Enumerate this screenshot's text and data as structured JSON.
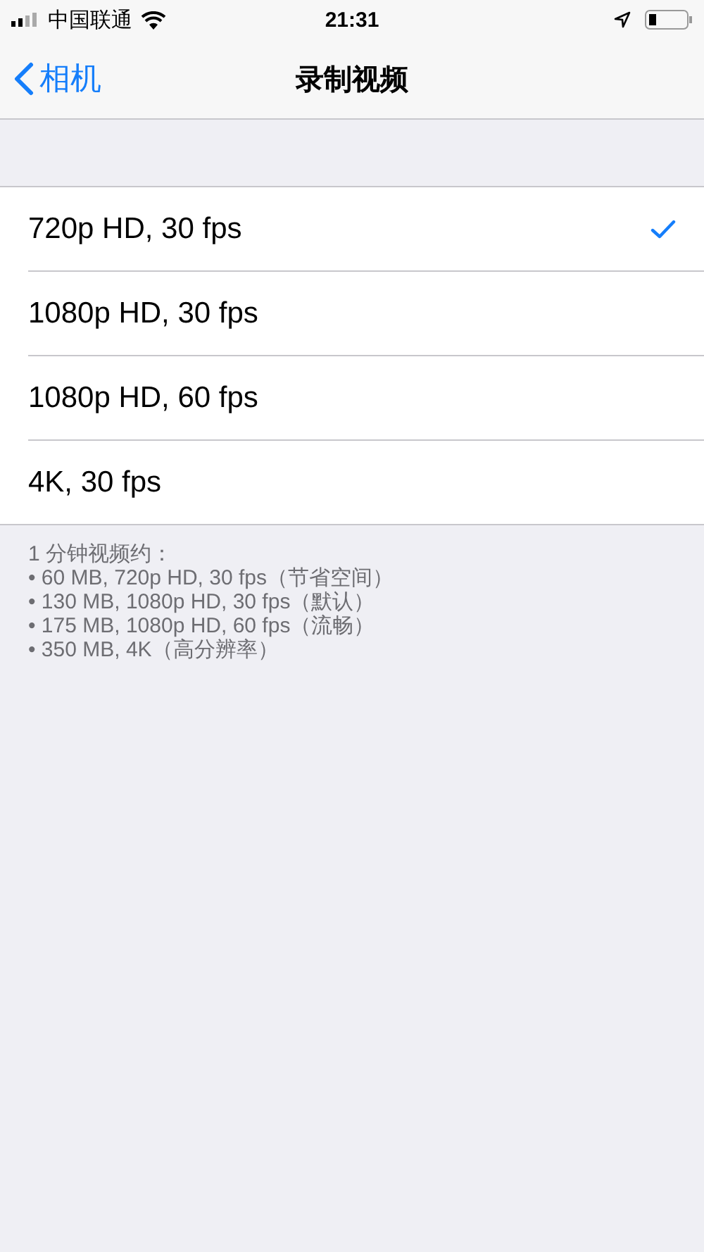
{
  "status_bar": {
    "carrier": "中国联通",
    "time": "21:31"
  },
  "nav": {
    "back": "相机",
    "title": "录制视频"
  },
  "options": [
    {
      "label": "720p HD, 30 fps",
      "selected": true
    },
    {
      "label": "1080p HD, 30 fps",
      "selected": false
    },
    {
      "label": "1080p HD, 60 fps",
      "selected": false
    },
    {
      "label": "4K, 30 fps",
      "selected": false
    }
  ],
  "footer": [
    "1 分钟视频约：",
    "• 60 MB, 720p HD, 30 fps（节省空间）",
    "• 130 MB, 1080p HD, 30 fps（默认）",
    "• 175 MB, 1080p HD, 60 fps（流畅）",
    "• 350 MB, 4K（高分辨率）"
  ]
}
